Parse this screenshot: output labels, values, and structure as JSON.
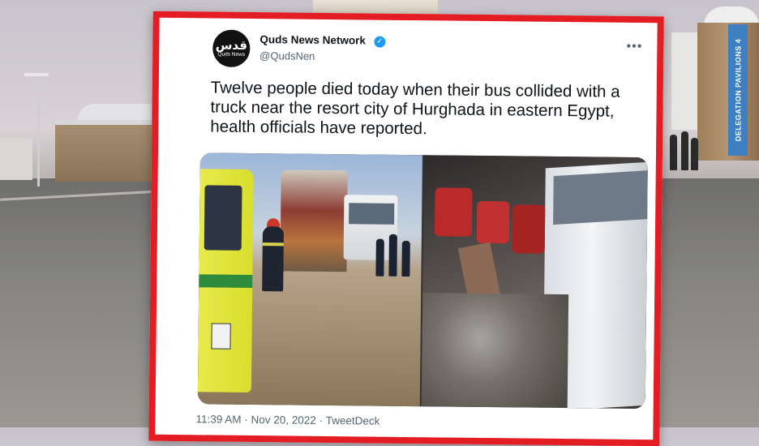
{
  "background": {
    "banner_text": "DELEGATION PAVILIONS 4"
  },
  "tweet": {
    "avatar": {
      "logo_arabic": "قدس",
      "logo_english": "Quds News"
    },
    "author_name": "Quds News Network",
    "author_handle": "@QudsNen",
    "verified": true,
    "more_icon": "•••",
    "verified_icon": "✓",
    "text": "Twelve people died today when their bus collided with a truck near the resort city of Hurghada in eastern Egypt, health officials have reported.",
    "timestamp": "11:39 AM · Nov 20, 2022 · TweetDeck",
    "frame_color": "#e41d24",
    "accent_color": "#1d9bf0"
  }
}
